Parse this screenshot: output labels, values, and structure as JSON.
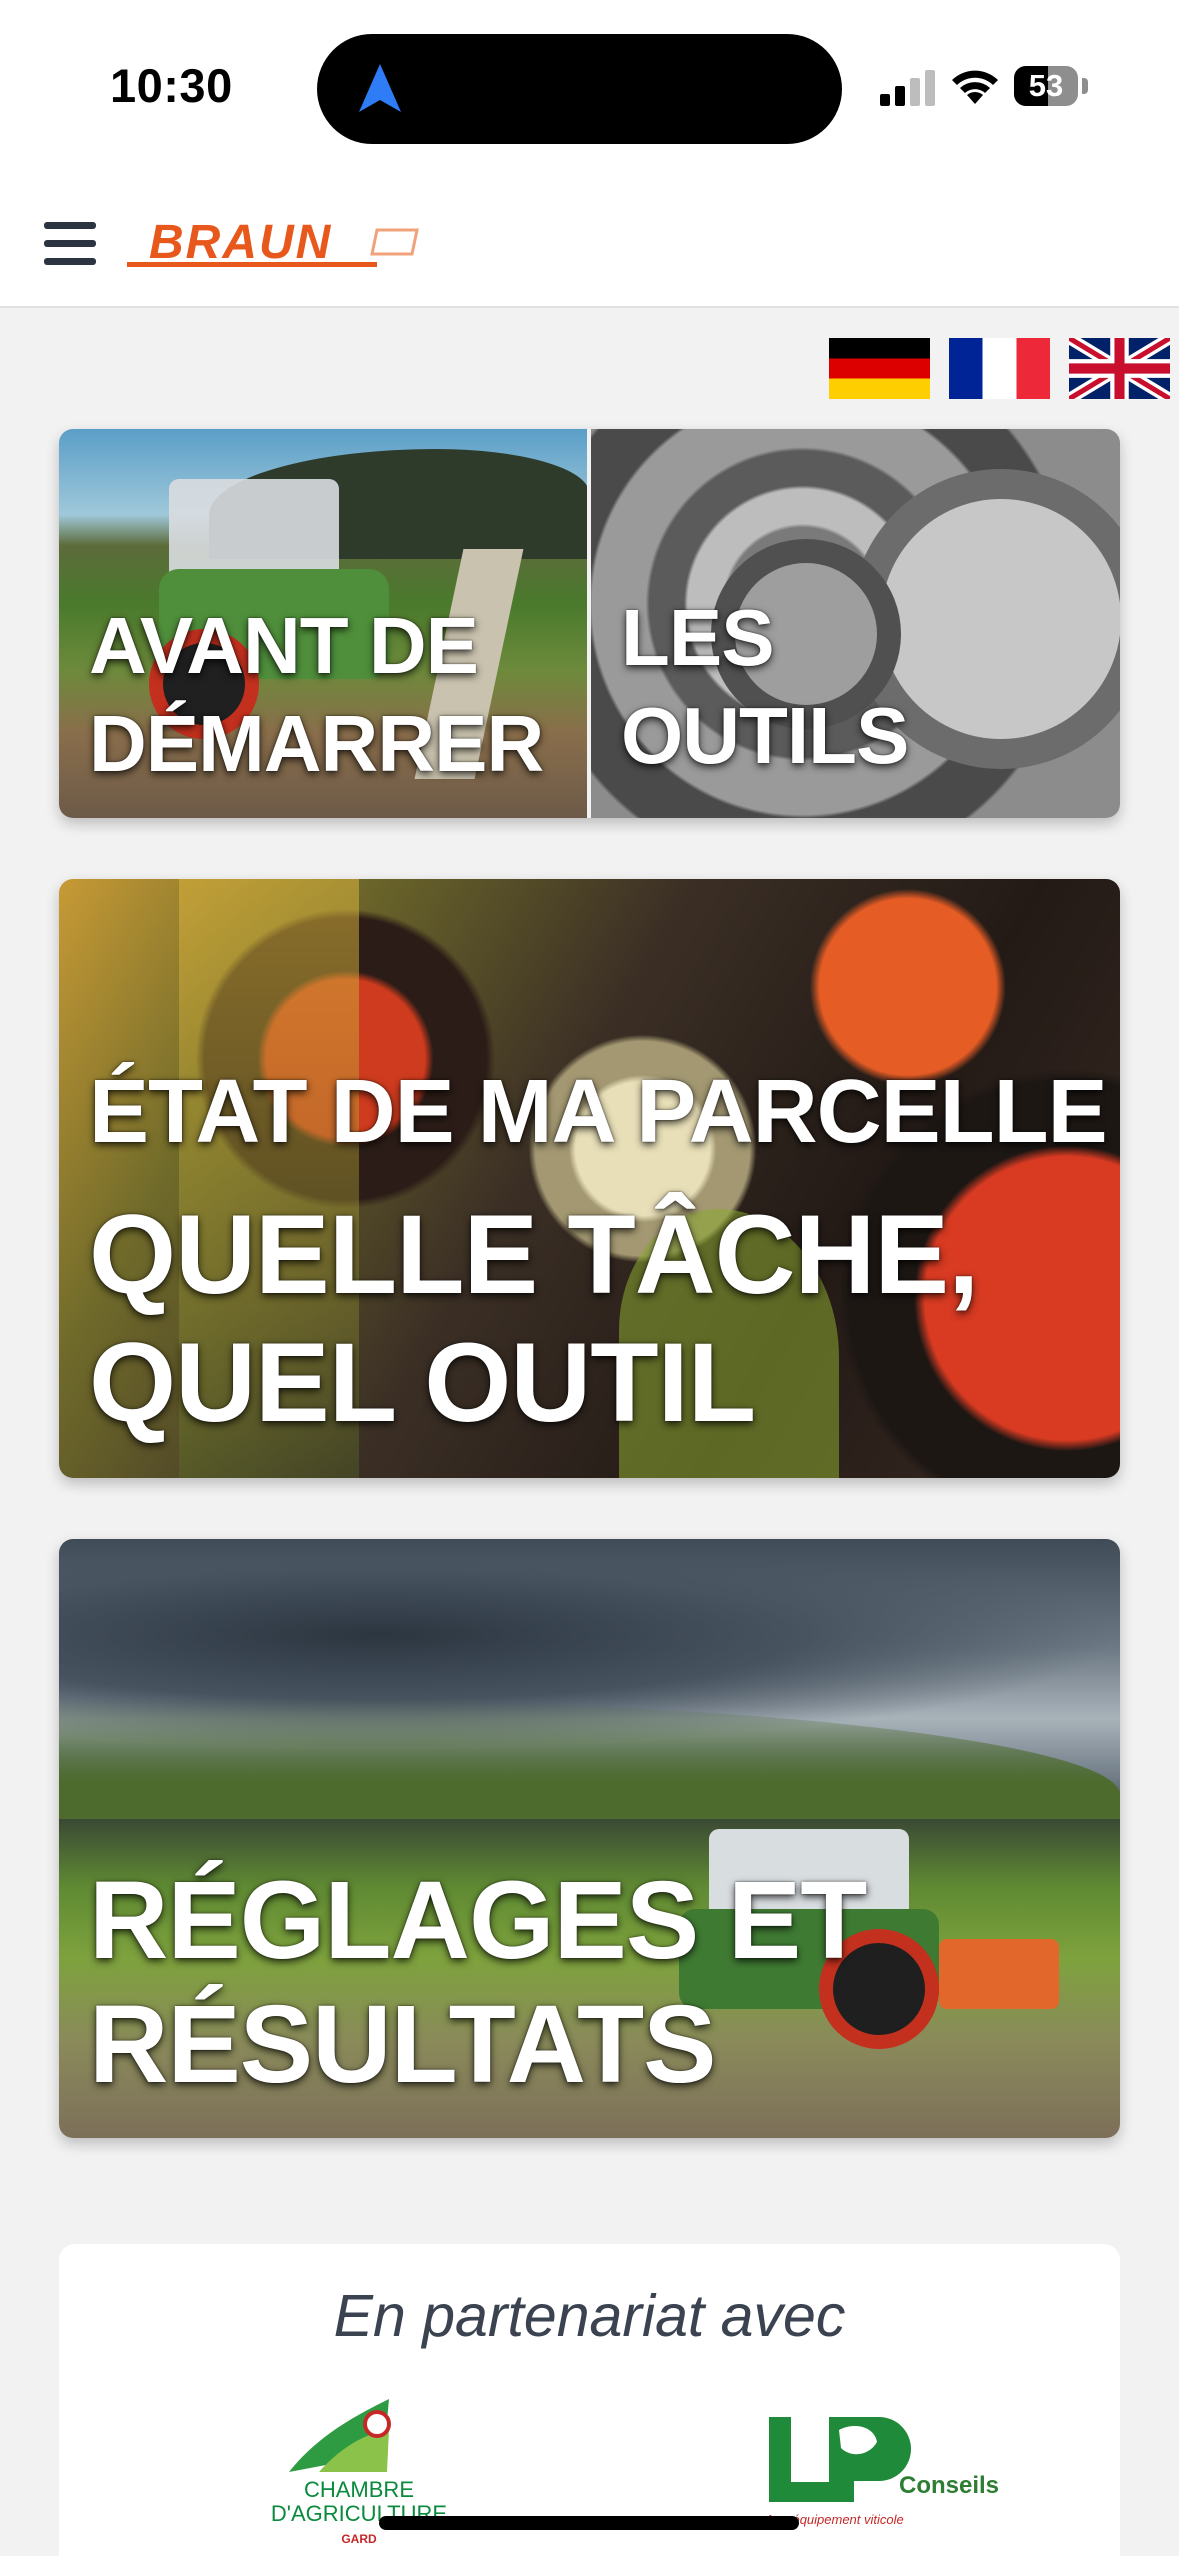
{
  "status_bar": {
    "time": "10:30",
    "battery_level": "53",
    "battery_fraction": 0.53,
    "icons": [
      "navigation-arrow-icon",
      "cellular-signal-icon",
      "wifi-icon",
      "battery-icon"
    ]
  },
  "header": {
    "logo_text": "BRAUN",
    "menu_icon": "hamburger-menu-icon"
  },
  "languages": [
    {
      "code": "de",
      "name": "German flag"
    },
    {
      "code": "fr",
      "name": "French flag"
    },
    {
      "code": "en",
      "name": "UK flag"
    }
  ],
  "cards": {
    "before_start": {
      "line1": "AVANT DE",
      "line2": "DÉMARRER"
    },
    "tools": {
      "line1": "LES",
      "line2": "OUTILS"
    },
    "parcel": {
      "title": "ÉTAT DE MA PARCELLE",
      "line1": "QUELLE TÂCHE,",
      "line2": "QUEL OUTIL"
    },
    "settings": {
      "line1": "RÉGLAGES ET",
      "line2": "RÉSULTATS"
    }
  },
  "partners": {
    "title": "En partenariat avec",
    "chambre": {
      "line1": "CHAMBRE",
      "line2": "D'AGRICULTURE",
      "sub": "GARD"
    },
    "lp": {
      "name": "Conseils",
      "sub": "Agroéquipement viticole"
    }
  },
  "colors": {
    "brand_orange": "#e8581c",
    "header_bg": "#ffffff",
    "page_bg": "#f2f2f2",
    "partner_green": "#0b8a3d"
  }
}
